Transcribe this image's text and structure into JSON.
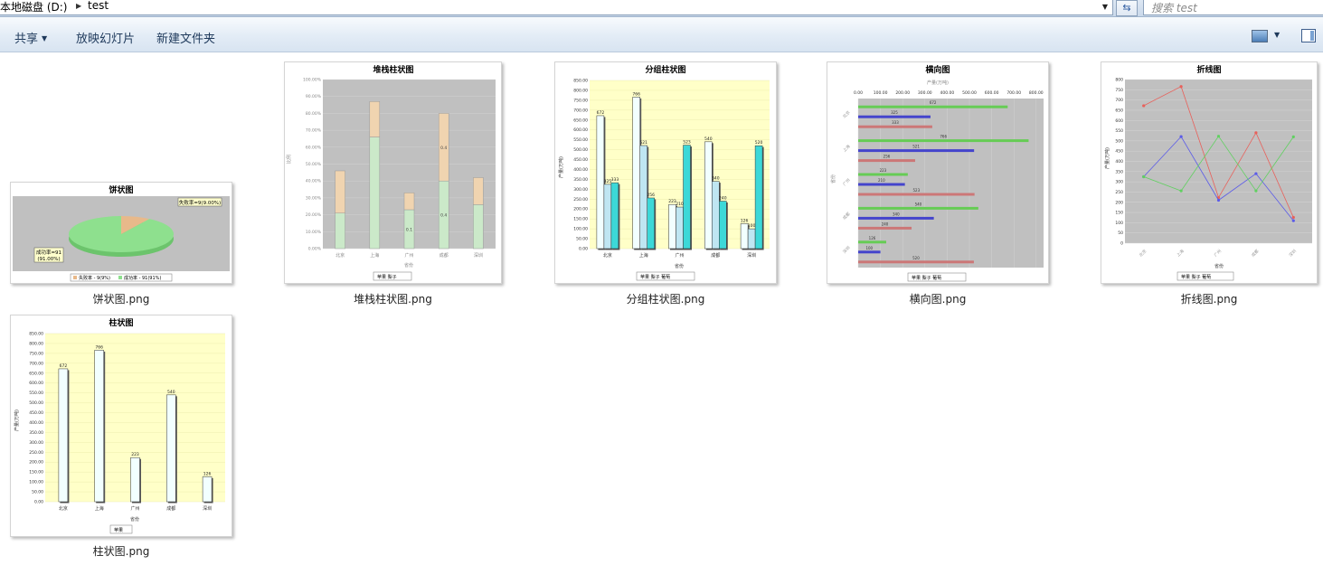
{
  "address": {
    "drive": "本地磁盘 (D:)",
    "folder": "test",
    "search_placeholder": "搜索 test"
  },
  "toolbar": {
    "share": "共享",
    "slideshow": "放映幻灯片",
    "new_folder": "新建文件夹"
  },
  "files": [
    {
      "name": "饼状图.png"
    },
    {
      "name": "堆栈柱状图.png"
    },
    {
      "name": "分组柱状图.png"
    },
    {
      "name": "横向图.png"
    },
    {
      "name": "折线图.png"
    },
    {
      "name": "柱状图.png"
    }
  ],
  "pie": {
    "title": "饼状图",
    "label_fail": "失败率=9(9.00%)",
    "label_ok_1": "成功率=91",
    "label_ok_2": "(91.00%)",
    "legend_fail": "失败率 - 9(9%)",
    "legend_ok": "成功率 - 91(91%)",
    "color_fail": "#e8b98a",
    "color_ok": "#8ee08e"
  },
  "stacked": {
    "title": "堆栈柱状图",
    "yticks": [
      "100.00%",
      "90.00%",
      "80.00%",
      "70.00%",
      "60.00%",
      "50.00%",
      "40.00%",
      "30.00%",
      "20.00%",
      "10.00%",
      "0.00%"
    ],
    "ylabel": "比例",
    "xlabel": "省份",
    "legend": "苹果 梨子",
    "chart_data": {
      "type": "bar",
      "categories": [
        "北京",
        "上海",
        "广州",
        "成都",
        "深圳"
      ],
      "series": [
        {
          "name": "苹果",
          "values": [
            0.21,
            0.66,
            0.23,
            0.4,
            0.26
          ]
        },
        {
          "name": "梨子",
          "values": [
            0.25,
            0.21,
            0.1,
            0.4,
            0.16
          ]
        }
      ],
      "ylim": [
        0,
        1
      ],
      "data_labels": [
        "0.1",
        "0.4",
        "0.4"
      ]
    }
  },
  "grouped": {
    "title": "分组柱状图",
    "ylabel": "产量(万吨)",
    "xlabel": "省份",
    "yticks": [
      "850.00",
      "800.00",
      "750.00",
      "700.00",
      "650.00",
      "600.00",
      "550.00",
      "500.00",
      "450.00",
      "400.00",
      "350.00",
      "300.00",
      "250.00",
      "200.00",
      "150.00",
      "100.00",
      "50.00",
      "0.00"
    ],
    "legend": "苹果 梨子 葡萄",
    "chart_data": {
      "type": "bar",
      "categories": [
        "北京",
        "上海",
        "广州",
        "成都",
        "深圳"
      ],
      "series": [
        {
          "name": "苹果",
          "values": [
            672,
            766,
            223,
            540,
            126
          ]
        },
        {
          "name": "梨子",
          "values": [
            325,
            521,
            210,
            340,
            100
          ]
        },
        {
          "name": "葡萄",
          "values": [
            333,
            256,
            523,
            240,
            520
          ]
        }
      ],
      "ylim": [
        0,
        850
      ]
    }
  },
  "horizontal": {
    "title": "横向图",
    "xlabel": "产量(万吨)",
    "ylabel": "省份",
    "xticks": [
      "0.00",
      "100.00",
      "200.00",
      "300.00",
      "400.00",
      "500.00",
      "600.00",
      "700.00",
      "800.00"
    ],
    "legend": "苹果 梨子 葡萄",
    "chart_data": {
      "type": "bar",
      "categories": [
        "北京",
        "上海",
        "广州",
        "成都",
        "深圳"
      ],
      "series": [
        {
          "name": "苹果",
          "values": [
            672,
            766,
            223,
            540,
            126
          ]
        },
        {
          "name": "梨子",
          "values": [
            325,
            521,
            210,
            340,
            100
          ]
        },
        {
          "name": "葡萄",
          "values": [
            333,
            256,
            523,
            240,
            520
          ]
        }
      ],
      "xlim": [
        0,
        800
      ]
    }
  },
  "line": {
    "title": "折线图",
    "ylabel": "产量(万吨)",
    "xlabel": "省份",
    "yticks": [
      "800",
      "750",
      "700",
      "650",
      "600",
      "550",
      "500",
      "450",
      "400",
      "350",
      "300",
      "250",
      "200",
      "150",
      "100",
      "50",
      "0"
    ],
    "legend": "苹果 梨子 葡萄",
    "chart_data": {
      "type": "line",
      "categories": [
        "北京",
        "上海",
        "广州",
        "成都",
        "深圳"
      ],
      "series": [
        {
          "name": "苹果",
          "values": [
            672,
            766,
            223,
            540,
            126
          ],
          "color": "#e8605a"
        },
        {
          "name": "梨子",
          "values": [
            325,
            521,
            210,
            340,
            110
          ],
          "color": "#5b5be8"
        },
        {
          "name": "葡萄",
          "values": [
            325,
            256,
            523,
            256,
            520
          ],
          "color": "#60d060"
        }
      ],
      "ylim": [
        0,
        800
      ]
    }
  },
  "single": {
    "title": "柱状图",
    "ylabel": "产量(万吨)",
    "xlabel": "省份",
    "yticks": [
      "850.00",
      "800.00",
      "750.00",
      "700.00",
      "650.00",
      "600.00",
      "550.00",
      "500.00",
      "450.00",
      "400.00",
      "350.00",
      "300.00",
      "250.00",
      "200.00",
      "150.00",
      "100.00",
      "50.00",
      "0.00"
    ],
    "legend": "苹果",
    "chart_data": {
      "type": "bar",
      "categories": [
        "北京",
        "上海",
        "广州",
        "成都",
        "深圳"
      ],
      "series": [
        {
          "name": "苹果",
          "values": [
            672,
            766,
            223,
            540,
            126
          ]
        }
      ],
      "ylim": [
        0,
        850
      ]
    }
  }
}
